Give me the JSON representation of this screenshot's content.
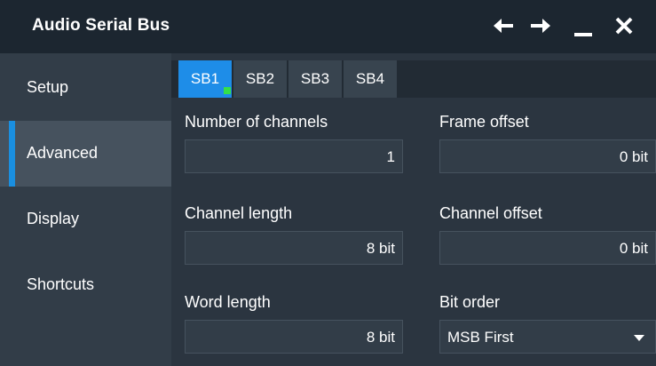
{
  "window": {
    "title": "Audio Serial Bus",
    "icons": [
      "arrow-left-icon",
      "arrow-right-icon",
      "minimize-icon",
      "close-icon"
    ]
  },
  "sidebar": {
    "items": [
      {
        "label": "Setup",
        "active": false
      },
      {
        "label": "Advanced",
        "active": true
      },
      {
        "label": "Display",
        "active": false
      },
      {
        "label": "Shortcuts",
        "active": false
      }
    ]
  },
  "tabs": [
    {
      "label": "SB1",
      "active": true,
      "status_indicator": true
    },
    {
      "label": "SB2",
      "active": false
    },
    {
      "label": "SB3",
      "active": false
    },
    {
      "label": "SB4",
      "active": false
    }
  ],
  "fields": {
    "num_channels": {
      "label": "Number of channels",
      "value": "1"
    },
    "frame_offset": {
      "label": "Frame offset",
      "value": "0 bit"
    },
    "channel_length": {
      "label": "Channel length",
      "value": "8 bit"
    },
    "channel_offset": {
      "label": "Channel offset",
      "value": "0 bit"
    },
    "word_length": {
      "label": "Word length",
      "value": "8 bit"
    },
    "bit_order": {
      "label": "Bit order",
      "value": "MSB First"
    }
  },
  "colors": {
    "accent": "#1e8de8",
    "status_dot": "#34e04a",
    "background": "#2b3540"
  }
}
